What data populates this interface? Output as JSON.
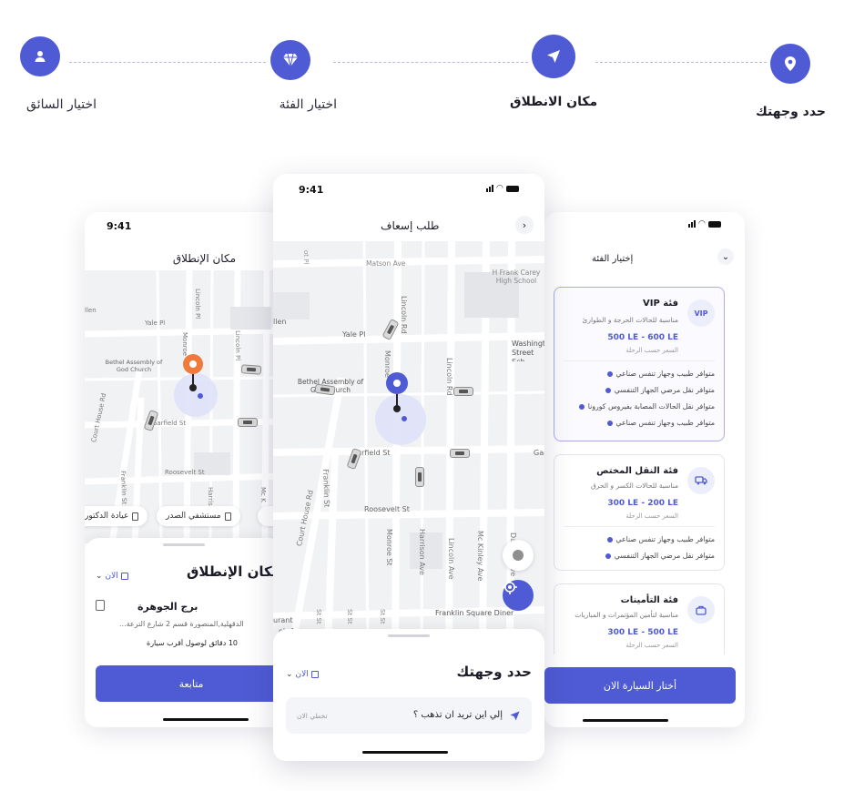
{
  "stepper": {
    "steps": [
      {
        "label": "حدد وجهتك"
      },
      {
        "label": "مكان الانطلاق"
      },
      {
        "label": "اختيار الفئة"
      },
      {
        "label": "اختيار السائق"
      }
    ]
  },
  "screen_pickup": {
    "time": "9:41",
    "title": "مكان الإنطلاق",
    "map_labels": {
      "yale": "Yale Pl",
      "church": "Bethel Assembly of God Church",
      "garfield": "Garfield St",
      "roosevelt": "Roosevelt St",
      "courthouse": "Court House Rd",
      "franklin": "Franklin St",
      "lincoln": "Lincoln Pl",
      "monroe": "Monroe",
      "allen": "llen",
      "harris": "Harris",
      "mc": "Mc K"
    },
    "chips": [
      "عيادة الدكتور",
      "مستشفي الصدر",
      "ل"
    ],
    "sheet_title": "مكان الإنطلاق",
    "now_label": "الان",
    "place_name": "برج الجوهرة",
    "place_address": "الدقهلية,المنصورة قسم 2 شارع الترعة...",
    "eta": "10 دقائق لوصول أقرب سيارة",
    "continue_label": "متابعة"
  },
  "screen_request": {
    "time": "9:41",
    "title": "طلب إسعاف",
    "map_labels": {
      "matson": "Matson Ave",
      "school": "H Frank Carey High School",
      "yale": "Yale Pl",
      "allen": "llen",
      "church": "Bethel Assembly of God Church",
      "washington": "Washington Street Sch",
      "garfield": "Garfield St",
      "gar": "Gar",
      "roosevelt": "Roosevelt St",
      "courthouse": "Court House Rd",
      "franklin": "Franklin St",
      "monroe": "Monroe St",
      "harrison": "Harrison Ave",
      "lincoln": "Lincoln Ave",
      "mckinley": "Mc Kinley Ave",
      "daffodil": "Daffodil Ave",
      "lincolnrd": "Lincoln Rd",
      "diner": "Franklin Square Diner",
      "monroe_top": "Monroe",
      "street_lower_1": "St St",
      "street_lower_2": "St St",
      "street_lower_3": "St St",
      "ob_ave": "ob Ave",
      "urant": "urant",
      "pl_top": "ot Pl"
    },
    "sheet_title": "حدد وجهتك",
    "now_label": "الان",
    "search_placeholder": "إلي اين تريد ان تذهب ؟",
    "skip_label": "تخطي الان"
  },
  "screen_category": {
    "title": "إختيار الفئة",
    "cards": [
      {
        "name": "فئة VIP",
        "desc": "مناسبة للحالات الحرجة و الطوارئ",
        "price": "500 LE - 600 LE",
        "price_sub": "السعر حسب الرحلة",
        "icon_text": "VIP",
        "features": [
          "متوافر طبيب وجهاز تنفس صناعي",
          "متوافر نقل مرضي الجهاز التنفسي",
          "متوافر نقل الحالات المصابة بفيروس كورونا",
          "متوافر طبيب وجهاز تنفس صناعي"
        ]
      },
      {
        "name": "فئة النقل المختص",
        "desc": "مناسبة للحالات الكسر و الحرق",
        "price": "300 LE - 200 LE",
        "price_sub": "السعر حسب الرحلة",
        "icon_text": "",
        "features": [
          "متوافر طبيب وجهاز تنفس صناعي",
          "متوافر نقل مرضي الجهاز التنفسي"
        ]
      },
      {
        "name": "فئة التأمينات",
        "desc": "مناسبة لتأمين المؤتمرات و المباريات",
        "price": "300 LE - 500 LE",
        "price_sub": "السعر حسب الرحلة",
        "icon_text": "",
        "features": []
      }
    ],
    "choose_label": "أختار السيارة الان"
  },
  "colors": {
    "accent": "#4f5bd5",
    "pickup_pin": "#f07a3c"
  }
}
